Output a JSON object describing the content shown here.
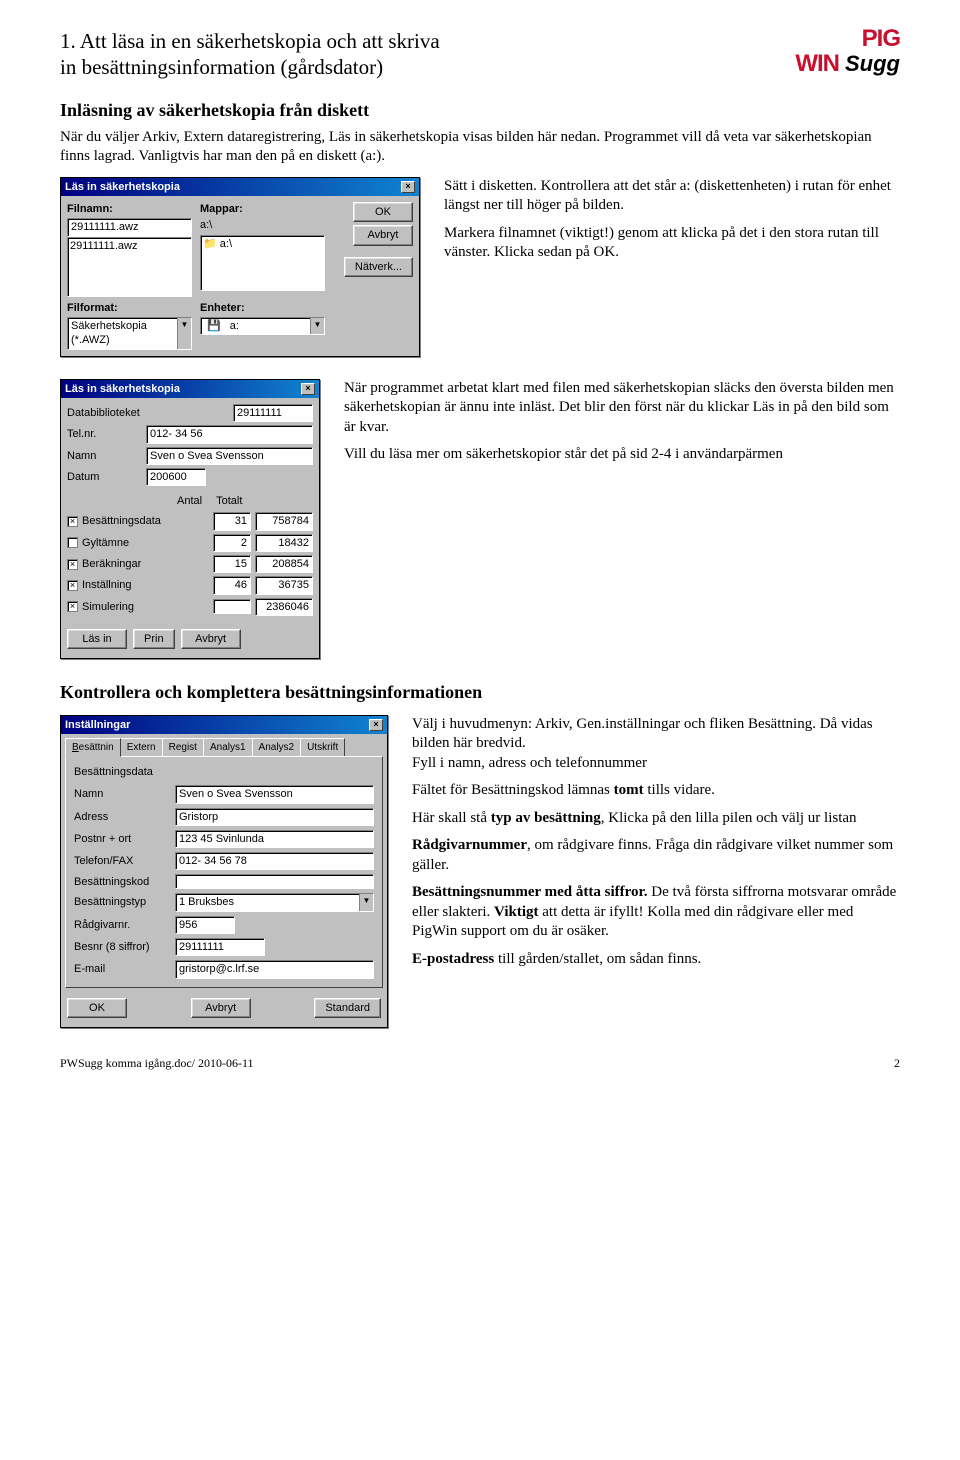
{
  "header": {
    "title_line1": "1. Att läsa in en säkerhetskopia och att skriva",
    "title_line2": "in besättningsinformation  (gårdsdator)",
    "logo_pig": "PIG",
    "logo_win": "WIN",
    "logo_sugg": "Sugg"
  },
  "section1": {
    "subtitle": "Inläsning av säkerhetskopia från diskett",
    "intro": "När du väljer Arkiv, Extern dataregistrering, Läs in säkerhetskopia visas bilden här nedan. Programmet vill då veta var säkerhetskopian finns lagrad. Vanligtvis har man den på en diskett (a:).",
    "side_p1": "Sätt i disketten. Kontrollera att det står a: (diskettenheten) i rutan för enhet längst ner till höger på bilden.",
    "side_p2": "Markera filnamnet (viktigt!) genom att klicka på det i den stora rutan till vänster. Klicka sedan på OK."
  },
  "dialog1": {
    "title": "Läs in säkerhetskopia",
    "lbl_filnamn": "Filnamn:",
    "filnamn_value": "29111111.awz",
    "list_item": "29111111.awz",
    "lbl_mappar": "Mappar:",
    "mappar_value": "a:\\",
    "tree_item": "a:\\",
    "lbl_filformat": "Filformat:",
    "filformat_value": "Säkerhetskopia (*.AWZ)",
    "lbl_enheter": "Enheter:",
    "enheter_value": "a:",
    "btn_ok": "OK",
    "btn_avbryt": "Avbryt",
    "btn_natverk": "Nätverk..."
  },
  "section2": {
    "p1": "När programmet arbetat klart med filen med säkerhetskopian släcks den översta bilden men säkerhetskopian är ännu inte inläst. Det blir den först när du klickar Läs in på den bild som är kvar.",
    "p2": "Vill du läsa mer om säkerhetskopior står det på sid 2-4 i användarpärmen"
  },
  "dialog2": {
    "title": "Läs in säkerhetskopia",
    "lbl_databib": "Databiblioteket",
    "databib_value": "29111111",
    "lbl_tel": "Tel.nr.",
    "tel_value": "012- 34 56",
    "lbl_namn": "Namn",
    "namn_value": "Sven o Svea Svensson",
    "lbl_datum": "Datum",
    "datum_value": "200600",
    "hdr_antal": "Antal",
    "hdr_totalt": "Totalt",
    "rows": [
      {
        "label": "Besättningsdata",
        "antal": "31",
        "totalt": "758784",
        "checked": true
      },
      {
        "label": "Gyltämne",
        "antal": "2",
        "totalt": "18432",
        "checked": false
      },
      {
        "label": "Beräkningar",
        "antal": "15",
        "totalt": "208854",
        "checked": true
      },
      {
        "label": "Inställning",
        "antal": "46",
        "totalt": "36735",
        "checked": true
      },
      {
        "label": "Simulering",
        "antal": "",
        "totalt": "2386046",
        "checked": true
      }
    ],
    "btn_lasin": "Läs in",
    "btn_prin": "Prin",
    "btn_avbryt": "Avbryt"
  },
  "section3": {
    "title": "Kontrollera och komplettera besättningsinformationen",
    "p1a": "Välj i huvudmenyn: Arkiv, Gen.inställningar och fliken Besättning. Då vidas bilden här bredvid.",
    "p1b": "Fyll i namn, adress och telefonnummer",
    "p2_pre": "Fältet för Besättningskod lämnas ",
    "p2_bold": "tomt",
    "p2_post": " tills vidare.",
    "p3_pre": "Här skall stå ",
    "p3_bold": "typ av besättning",
    "p3_post": ", Klicka på den lilla pilen och välj ur listan",
    "p4_bold": "Rådgivarnummer",
    "p4_post": ", om rådgivare finns. Fråga din rådgivare vilket nummer som gäller.",
    "p5_bold": "Besättningsnummer med åtta siffror.",
    "p5_mid": " De två första siffrorna motsvarar område eller slakteri. ",
    "p5_bold2": "Viktigt",
    "p5_post": " att detta är ifyllt! Kolla med din rådgivare eller med PigWin support om du är osäker.",
    "p6_bold": "E-postadress",
    "p6_post": " till gården/stallet, om sådan finns."
  },
  "dialog3": {
    "title": "Inställningar",
    "tabs": {
      "t1": "Besättnin",
      "t2": "Extern",
      "t3": "Regist",
      "t4": "Analys1",
      "t5": "Analys2",
      "t6": "Utskrift"
    },
    "group": "Besättningsdata",
    "labels": {
      "namn": "Namn",
      "adress": "Adress",
      "postort": "Postnr + ort",
      "telefon": "Telefon/FAX",
      "beskod": "Besättningskod",
      "bestyp": "Besättningstyp",
      "radgivar": "Rådgivarnr.",
      "besnr": "Besnr (8 siffror)",
      "email": "E-mail"
    },
    "values": {
      "namn": "Sven o Svea Svensson",
      "adress": "Gristorp",
      "postort": "123 45 Svinlunda",
      "telefon": "012- 34 56 78",
      "beskod": "",
      "bestyp": "1 Bruksbes",
      "radgivar": "956",
      "besnr": "29111111",
      "email": "gristorp@c.lrf.se"
    },
    "btn_ok": "OK",
    "btn_avbryt": "Avbryt",
    "btn_standard": "Standard"
  },
  "footer": {
    "left": "PWSugg komma igång.doc/  2010-06-11",
    "right": "2"
  }
}
